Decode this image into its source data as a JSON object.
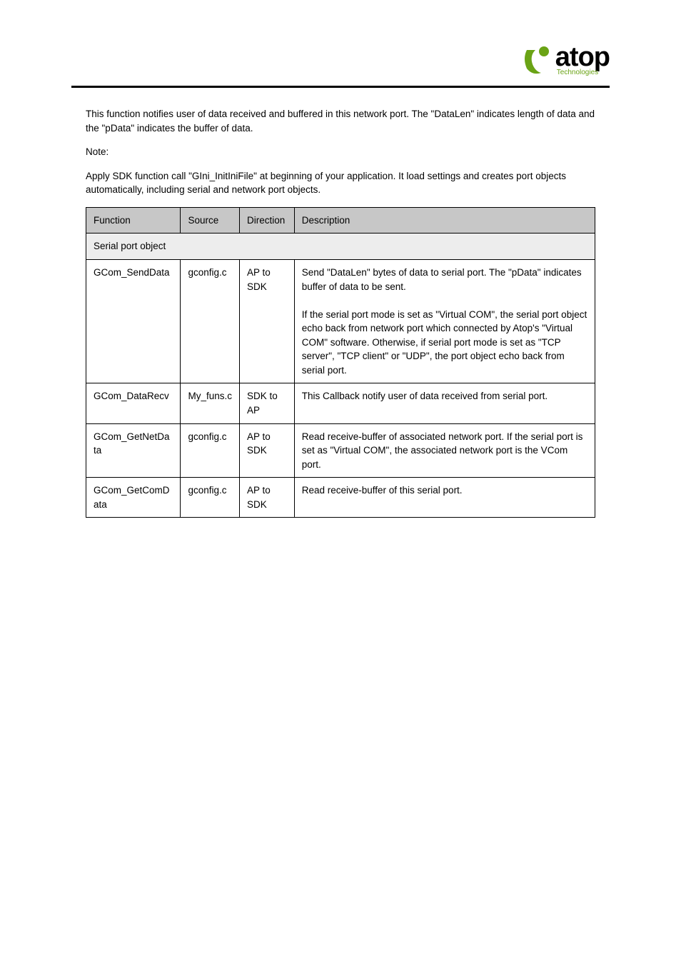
{
  "logo": {
    "brand": "atop",
    "sub": "Technologies"
  },
  "para1": "This function notifies user of data received and buffered in this network port. The \"DataLen\" indicates length of data and the \"pData\" indicates the buffer of data.",
  "note_title": "Note:",
  "note_body": "Apply SDK function call \"GIni_InitIniFile\" at beginning of your application. It load settings and creates port objects automatically, including serial and network port objects.",
  "table": {
    "headers": [
      "Function",
      "Source",
      "Direction",
      "Description"
    ],
    "sections": [
      {
        "title": "Serial port object",
        "rows": [
          {
            "f": "GCom_SendData",
            "s": "gconfig.c",
            "d": "AP to SDK",
            "desc": [
              "Send \"DataLen\" bytes of data to serial port. The \"pData\" indicates buffer of data to be sent.",
              "",
              "If the serial port mode is set as \"Virtual COM\", the serial port object echo back from network port which connected by Atop's \"Virtual COM\" software. Otherwise, if serial port mode is set as \"TCP server\", \"TCP client\" or \"UDP\", the port object echo back from serial port."
            ]
          },
          {
            "f": "GCom_DataRecv",
            "s": "My_funs.c",
            "d": "SDK to AP",
            "desc": [
              "This Callback notify user of data received from serial port."
            ]
          },
          {
            "f": "GCom_GetNetDa ta",
            "s": "gconfig.c",
            "d": "AP to SDK",
            "desc": [
              "Read receive-buffer of associated network port. If the serial port is set as \"Virtual COM\", the associated network port is the VCom port."
            ]
          },
          {
            "f": "GCom_GetComD ata",
            "s": "gconfig.c",
            "d": "AP to SDK",
            "desc": [
              "Read receive-buffer of this serial port."
            ]
          }
        ]
      }
    ]
  }
}
